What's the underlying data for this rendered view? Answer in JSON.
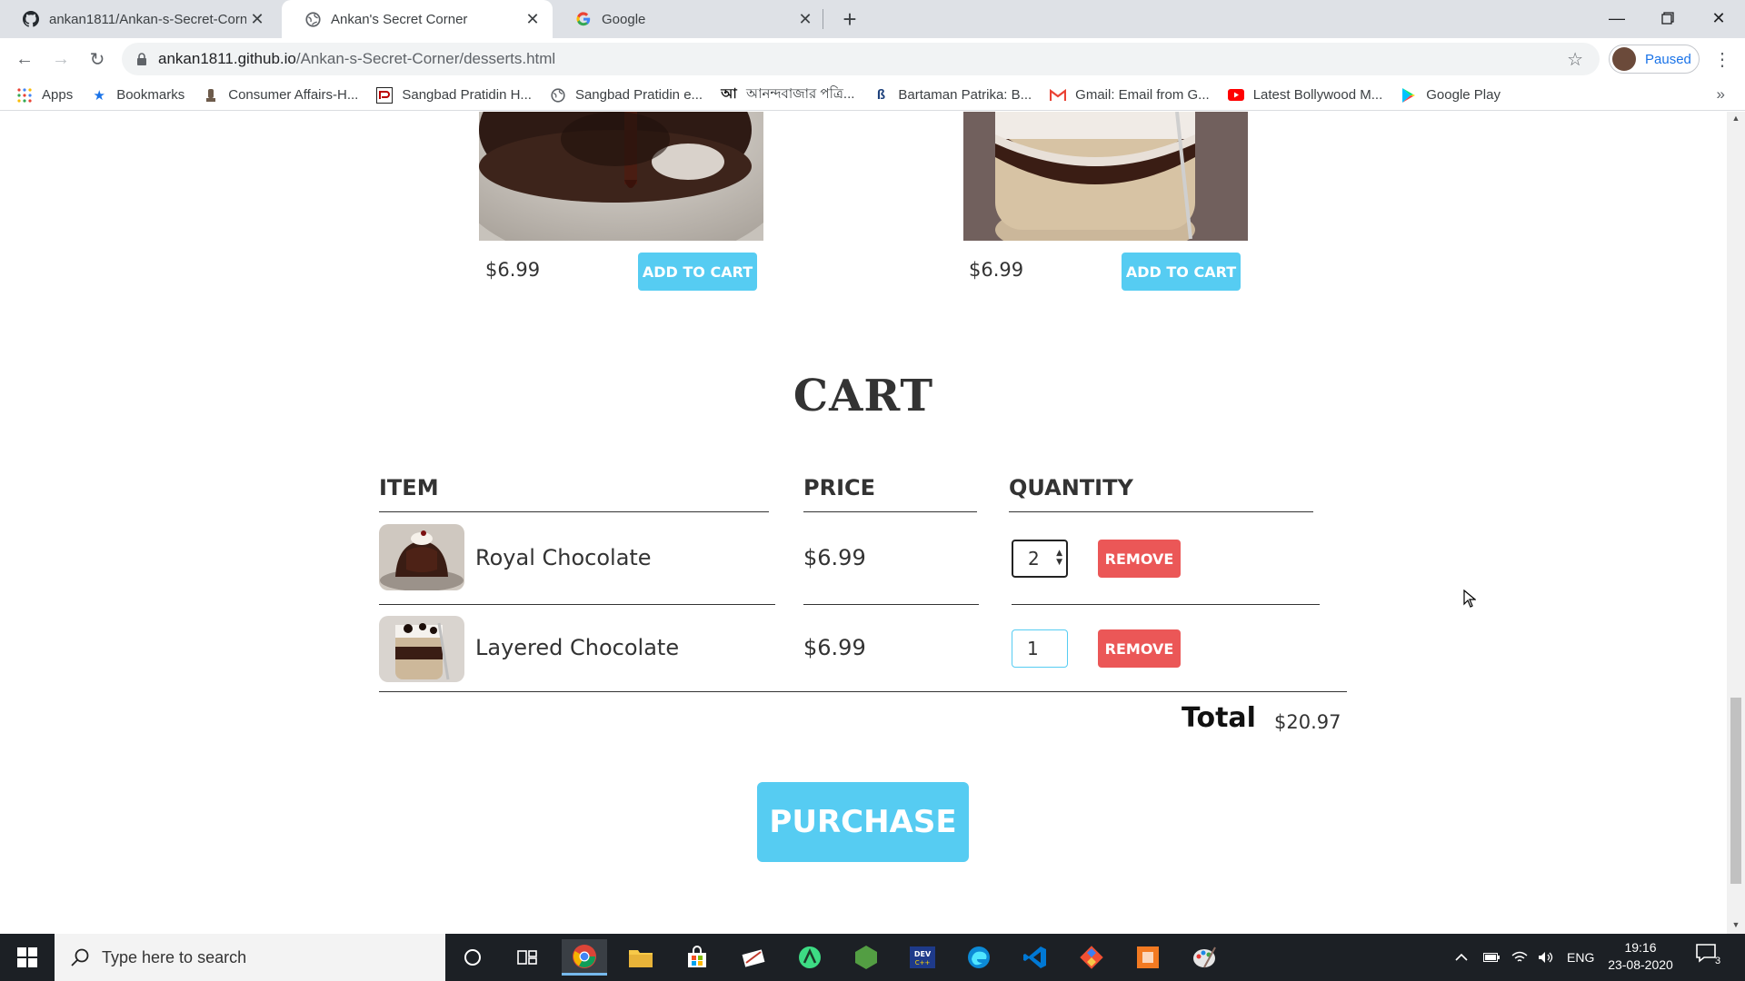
{
  "browser": {
    "tabs": [
      {
        "title": "ankan1811/Ankan-s-Secret-Corn",
        "icon": "github-icon",
        "active": false
      },
      {
        "title": "Ankan's Secret Corner",
        "icon": "globe-icon",
        "active": true
      },
      {
        "title": "Google",
        "icon": "google-icon",
        "active": false
      }
    ],
    "url_host": "ankan1811.github.io",
    "url_path": "/Ankan-s-Secret-Corner/desserts.html",
    "profile_status": "Paused",
    "bookmarks": [
      {
        "label": "Apps",
        "icon": "apps-grid-icon"
      },
      {
        "label": "Bookmarks",
        "icon": "star-icon"
      },
      {
        "label": "Consumer Affairs-H...",
        "icon": "emblem-icon"
      },
      {
        "label": "Sangbad Pratidin H...",
        "icon": "pratidin-icon"
      },
      {
        "label": "Sangbad Pratidin e...",
        "icon": "globe-icon"
      },
      {
        "label": "আনন্দবাজার পত্রি...",
        "icon": "anandabazar-icon"
      },
      {
        "label": "Bartaman Patrika: B...",
        "icon": "bartaman-icon"
      },
      {
        "label": "Gmail: Email from G...",
        "icon": "gmail-icon"
      },
      {
        "label": "Latest Bollywood M...",
        "icon": "youtube-icon"
      },
      {
        "label": "Google Play",
        "icon": "google-play-icon"
      }
    ]
  },
  "shop_items": [
    {
      "price": "$6.99",
      "button": "ADD TO CART"
    },
    {
      "price": "$6.99",
      "button": "ADD TO CART"
    }
  ],
  "cart": {
    "title": "CART",
    "headers": {
      "item": "ITEM",
      "price": "PRICE",
      "quantity": "QUANTITY"
    },
    "rows": [
      {
        "name": "Royal Chocolate",
        "price": "$6.99",
        "quantity": "2",
        "remove": "REMOVE"
      },
      {
        "name": "Layered Chocolate",
        "price": "$6.99",
        "quantity": "1",
        "remove": "REMOVE"
      }
    ],
    "total_label": "Total",
    "total_value": "$20.97",
    "purchase": "PURCHASE"
  },
  "taskbar": {
    "search_placeholder": "Type here to search",
    "language": "ENG",
    "time": "19:16",
    "date": "23-08-2020",
    "notifications": "3"
  },
  "colors": {
    "accent": "#56ccf2",
    "danger": "#eb5757"
  }
}
